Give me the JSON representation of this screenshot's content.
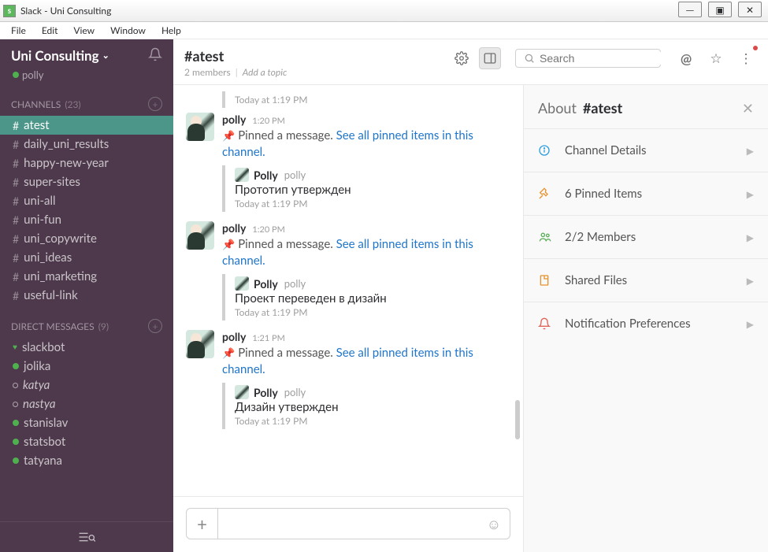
{
  "window": {
    "title": "Slack - Uni Consulting",
    "menu": [
      "File",
      "Edit",
      "View",
      "Window",
      "Help"
    ]
  },
  "team": {
    "name": "Uni Consulting",
    "current_user": "polly"
  },
  "channels_header": {
    "label": "CHANNELS",
    "count": "(23)"
  },
  "channels": [
    {
      "name": "atest",
      "active": true
    },
    {
      "name": "daily_uni_results"
    },
    {
      "name": "happy-new-year"
    },
    {
      "name": "super-sites"
    },
    {
      "name": "uni-all"
    },
    {
      "name": "uni-fun"
    },
    {
      "name": "uni_copywrite"
    },
    {
      "name": "uni_ideas"
    },
    {
      "name": "uni_marketing"
    },
    {
      "name": "useful-link"
    }
  ],
  "dms_header": {
    "label": "DIRECT MESSAGES",
    "count": "(9)"
  },
  "dms": [
    {
      "name": "slackbot",
      "presence": "heart"
    },
    {
      "name": "jolika",
      "presence": "active"
    },
    {
      "name": "katya",
      "presence": "away",
      "italic": true
    },
    {
      "name": "nastya",
      "presence": "away",
      "italic": true
    },
    {
      "name": "stanislav",
      "presence": "active"
    },
    {
      "name": "statsbot",
      "presence": "active"
    },
    {
      "name": "tatyana",
      "presence": "active"
    }
  ],
  "channel_header": {
    "title": "#atest",
    "members": "2 members",
    "add_topic": "Add a topic"
  },
  "search": {
    "placeholder": "Search"
  },
  "stray_preview_time": "Today at 1:19 PM",
  "messages": [
    {
      "author": "polly",
      "time": "1:20 PM",
      "pinned_text_pre": "Pinned a message. ",
      "pinned_link": "See all pinned items in this channel.",
      "preview": {
        "author": "Polly",
        "user": "polly",
        "text": "Прототип утвержден",
        "time": "Today at 1:19 PM"
      }
    },
    {
      "author": "polly",
      "time": "1:20 PM",
      "pinned_text_pre": "Pinned a message. ",
      "pinned_link": "See all pinned items in this channel.",
      "preview": {
        "author": "Polly",
        "user": "polly",
        "text": "Проект переведен в дизайн",
        "time": "Today at 1:19 PM"
      }
    },
    {
      "author": "polly",
      "time": "1:21 PM",
      "pinned_text_pre": "Pinned a message. ",
      "pinned_link": "See all pinned items in this channel.",
      "preview": {
        "author": "Polly",
        "user": "polly",
        "text": "Дизайн утвержден",
        "time": "Today at 1:19 PM"
      }
    }
  ],
  "about": {
    "label": "About",
    "channel": "#atest",
    "sections": [
      {
        "icon": "info",
        "label": "Channel Details"
      },
      {
        "icon": "pin",
        "label": "6 Pinned Items"
      },
      {
        "icon": "members",
        "label": "2/2 Members"
      },
      {
        "icon": "files",
        "label": "Shared Files"
      },
      {
        "icon": "bell",
        "label": "Notification Preferences"
      }
    ]
  }
}
